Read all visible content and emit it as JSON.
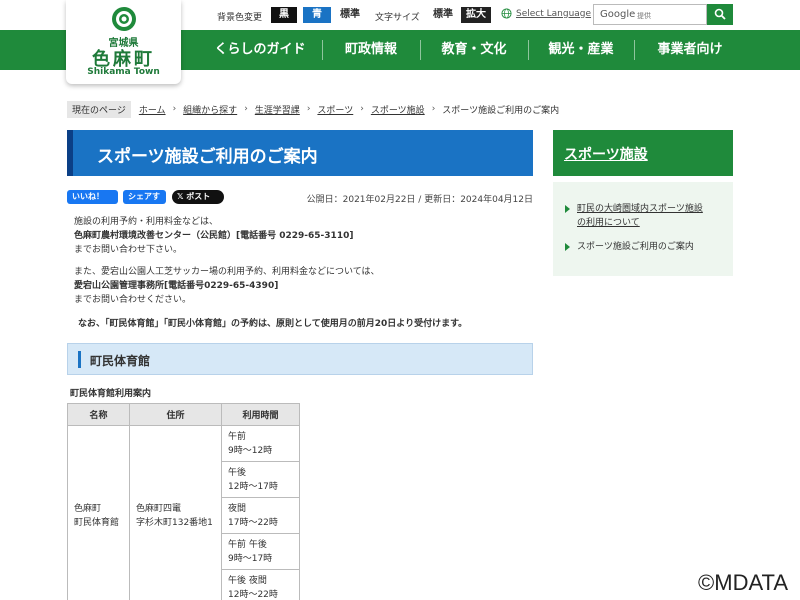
{
  "logo": {
    "pref": "宮城県",
    "town": "色麻町",
    "en": "Shikama Town"
  },
  "toolbar": {
    "bg_label": "背景色変更",
    "bg_black": "黒",
    "bg_blue": "青",
    "bg_standard": "標準",
    "fs_label": "文字サイズ",
    "fs_standard": "標準",
    "fs_large": "拡大",
    "language": "Select Language",
    "search_brand": "Google",
    "search_small": "提供"
  },
  "nav": [
    "くらしのガイド",
    "町政情報",
    "教育・文化",
    "観光・産業",
    "事業者向け"
  ],
  "breadcrumb": {
    "label": "現在のページ",
    "items": [
      "ホーム",
      "組織から探す",
      "生涯学習課",
      "スポーツ",
      "スポーツ施設"
    ],
    "current": "スポーツ施設ご利用のご案内"
  },
  "page_title": "スポーツ施設ご利用のご案内",
  "social": {
    "like": "いいね！",
    "share": "シェアする",
    "post": "ポスト"
  },
  "dates": "公開日：2021年02月22日 / 更新日：2024年04月12日",
  "body": {
    "p1_line1": "施設の利用予約・利用料金などは、",
    "p1_line2": "色麻町農村環境改善センター（公民館）[電話番号 0229-65-3110]",
    "p1_line3": "までお問い合わせ下さい。",
    "p2_line1": "また、愛宕山公園人工芝サッカー場の利用予約、利用料金などについては、",
    "p2_line2": "愛宕山公園管理事務所[電話番号0229-65-4390]",
    "p2_line3": "までお問い合わせください。",
    "note": "なお、「町民体育館」「町民小体育館」の予約は、原則として使用月の前月20日より受付けます。"
  },
  "section": {
    "title": "町民体育館",
    "caption": "町民体育館利用案内",
    "headers": [
      "名称",
      "住所",
      "利用時間"
    ],
    "name_line1": "色麻町",
    "name_line2": "町民体育館",
    "addr_line1": "色麻町四竃",
    "addr_line2": "字杉木町132番地1",
    "times": [
      {
        "a": "午前",
        "b": "9時～12時"
      },
      {
        "a": "午後",
        "b": "12時～17時"
      },
      {
        "a": "夜間",
        "b": "17時～22時"
      },
      {
        "a": "午前 午後",
        "b": "9時～17時"
      },
      {
        "a": "午後 夜間",
        "b": "12時～22時"
      }
    ]
  },
  "sidebar": {
    "title": "スポーツ施設",
    "item1_line1": "町民の大崎圏域内スポーツ施設",
    "item1_line2": "の利用について",
    "item2": "スポーツ施設ご利用のご案内"
  },
  "watermark": "©MDATA",
  "colors": {
    "green": "#1f8a3b",
    "blue": "#1a73c4",
    "section_bg": "#d6e8f7"
  }
}
